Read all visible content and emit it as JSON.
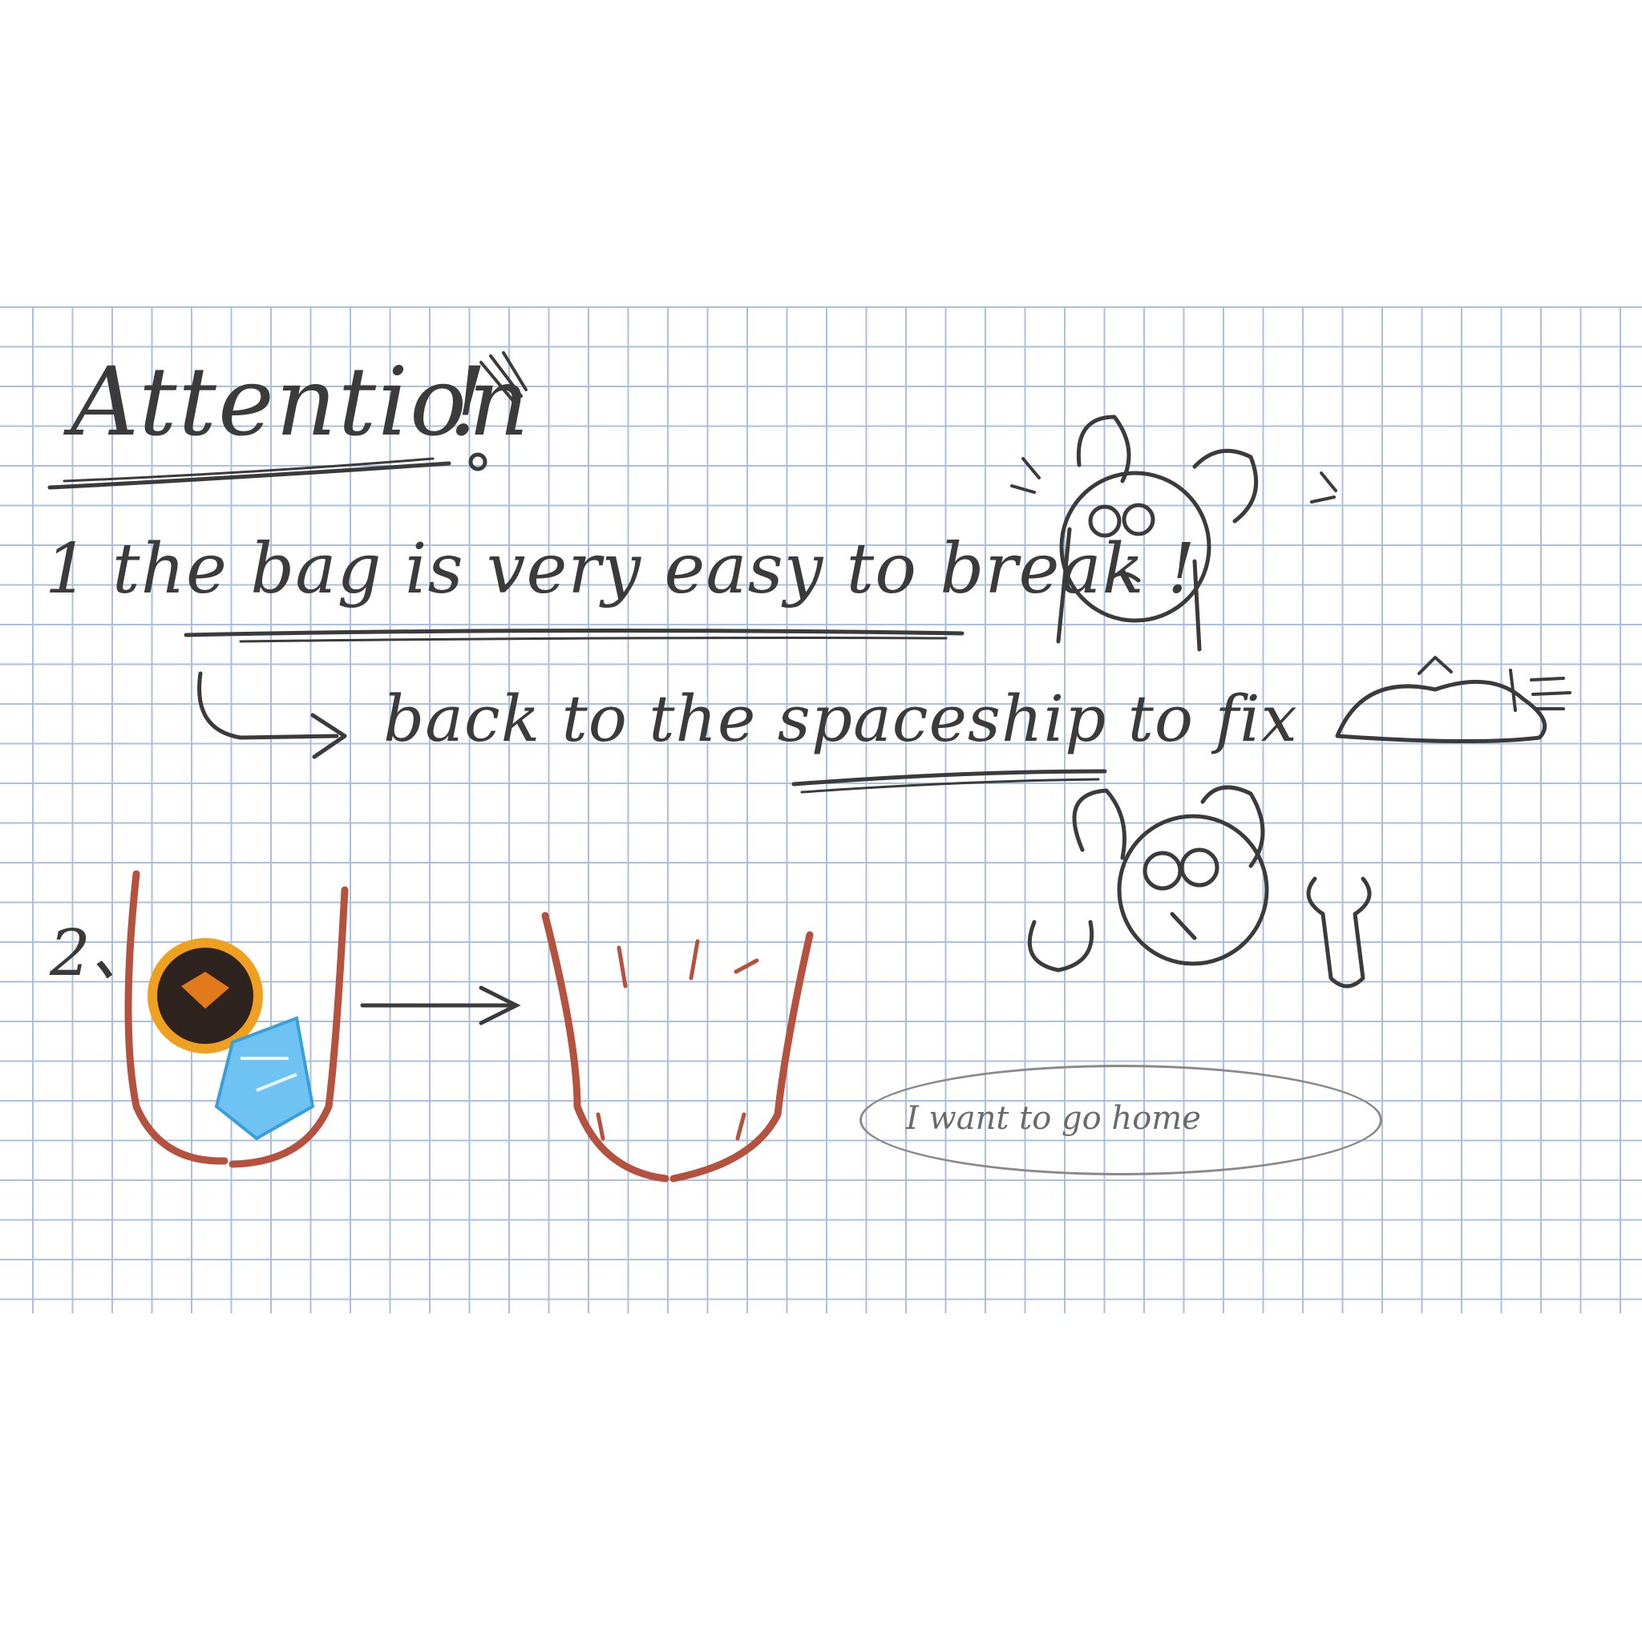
{
  "heading": {
    "title": "Attention",
    "mark": "!"
  },
  "item1": {
    "text": "1 the bag is very easy to break !"
  },
  "item1_followup": {
    "text": "back to the spaceship to fix"
  },
  "item2": {
    "number": "2、"
  },
  "speech_bubble": {
    "text": "I want to go home"
  },
  "colors": {
    "grid": "#a9c0de",
    "ink": "#3b3b3b",
    "bag": "#b5513f",
    "ore_dark": "#2f2320",
    "ore_glow": "#f0a020",
    "crystal": "#6ec3f2"
  }
}
